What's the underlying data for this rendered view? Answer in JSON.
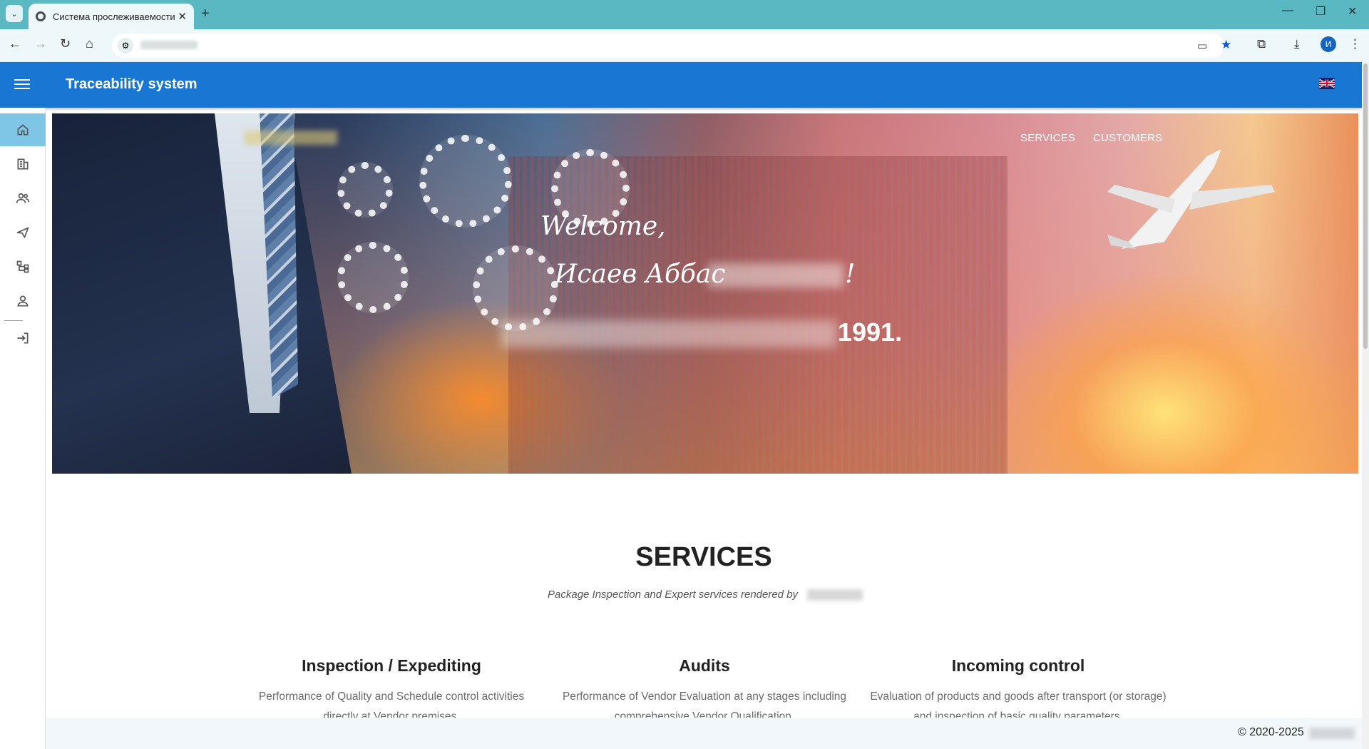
{
  "browser": {
    "tab_title": "Система прослеживаемости",
    "tab_close": "✕",
    "new_tab": "+",
    "window": {
      "minimize": "—",
      "restore": "❐",
      "close": "✕"
    },
    "nav": {
      "back": "←",
      "forward": "→",
      "reload": "↻",
      "home": "⌂"
    },
    "avatar_letter": "И",
    "icons": [
      "install-app-icon",
      "bookmark-star-icon",
      "extensions-icon",
      "download-icon",
      "menu-dots-icon"
    ]
  },
  "app": {
    "title": "Traceability system",
    "language": "en-GB"
  },
  "sidebar": {
    "items": [
      {
        "id": "home",
        "icon": "home-icon",
        "active": true
      },
      {
        "id": "companies",
        "icon": "building-icon",
        "active": false
      },
      {
        "id": "users",
        "icon": "users-icon",
        "active": false
      },
      {
        "id": "send",
        "icon": "send-icon",
        "active": false
      },
      {
        "id": "structure",
        "icon": "hierarchy-icon",
        "active": false
      },
      {
        "id": "profile",
        "icon": "person-icon",
        "active": false
      },
      {
        "id": "logout",
        "icon": "logout-icon",
        "active": false
      }
    ]
  },
  "hero": {
    "nav": [
      "SERVICES",
      "CUSTOMERS"
    ],
    "welcome_line1": "Welcome,",
    "welcome_line2": "Исаев Аббас",
    "exclamation": "!",
    "year": "1991."
  },
  "services": {
    "title": "SERVICES",
    "subtitle": "Package Inspection and Expert services rendered by",
    "items": [
      {
        "title": "Inspection / Expediting",
        "text": "Performance of Quality and Schedule control activities directly at Vendor premises."
      },
      {
        "title": "Audits",
        "text": "Performance of Vendor Evaluation at any stages including comprehensive Vendor Qualification."
      },
      {
        "title": "Incoming control",
        "text": "Evaluation of products and goods after transport (or storage) and inspection of basic quality parameters."
      }
    ]
  },
  "footer": {
    "copyright": "© 2020-2025"
  },
  "colors": {
    "appbar": "#1976d2",
    "tabbar": "#5ab8c2",
    "sidebar_active": "#7fc6e6"
  }
}
